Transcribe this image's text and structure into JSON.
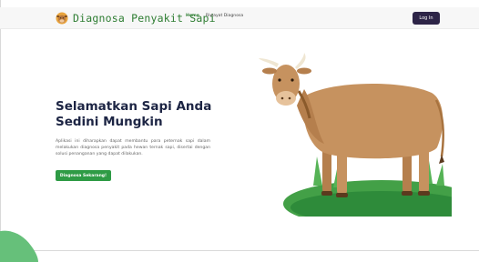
{
  "navbar": {
    "logo_icon": "cow-face-icon",
    "brand": "Diagnosa Penyakit Sapi",
    "links": [
      {
        "label": "Home",
        "active": true
      },
      {
        "label": "Riwayat Diagnosa",
        "active": false
      }
    ],
    "login_label": "Log In"
  },
  "hero": {
    "title": "Selamatkan Sapi Anda Sedini Mungkin",
    "description": "Aplikasi ini diharapkan dapat membantu para peternak sapi dalam melakukan diagnosa penyakit pada hewan ternak sapi, disertai dengan solusi penanganan yang dapat dilakukan.",
    "cta_label": "Diagnosa Sekarang!",
    "illustration": "cow-illustration"
  },
  "colors": {
    "brand_green": "#2e7d32",
    "cta_green": "#2e9b45",
    "login_bg": "#2d2447",
    "title_navy": "#1d2544",
    "cow_brown": "#c6925f",
    "grass_green": "#43a047"
  }
}
